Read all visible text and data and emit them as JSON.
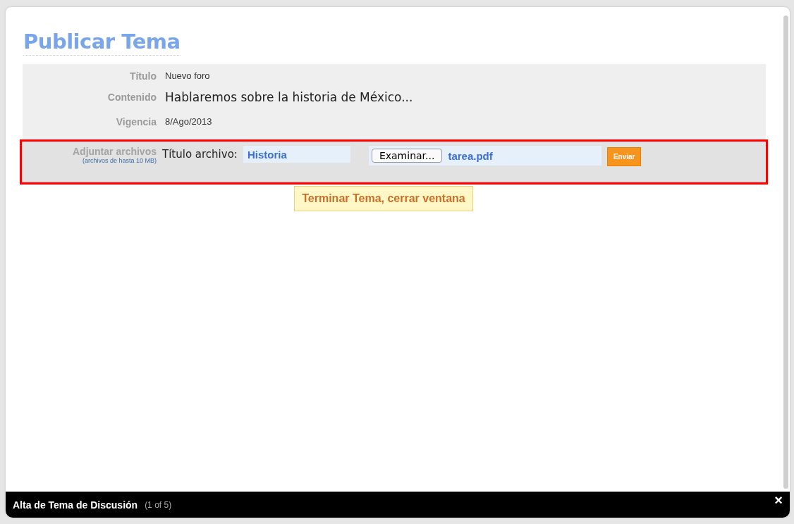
{
  "page": {
    "title": "Publicar Tema"
  },
  "fields": [
    {
      "label": "Título",
      "value": "Nuevo foro",
      "kind": "small"
    },
    {
      "label": "Contenido",
      "value": "Hablaremos sobre la historia de México...",
      "kind": "large"
    },
    {
      "label": "Vigencia",
      "value": "8/Ago/2013",
      "kind": "small"
    }
  ],
  "attachment": {
    "label": "Adjuntar archivos",
    "note": "(archivos de hasta 10 MB)",
    "title_label": "Título archivo:",
    "title_value": "Historia",
    "browse_button": "Examinar...",
    "file_name": "tarea.pdf",
    "send_button": "Enviar",
    "highlighted": true
  },
  "finish_button": "Terminar Tema, cerrar ventana",
  "footer": {
    "title": "Alta de Tema de Discusión",
    "counter": "(1 of 5)",
    "close": "×"
  }
}
